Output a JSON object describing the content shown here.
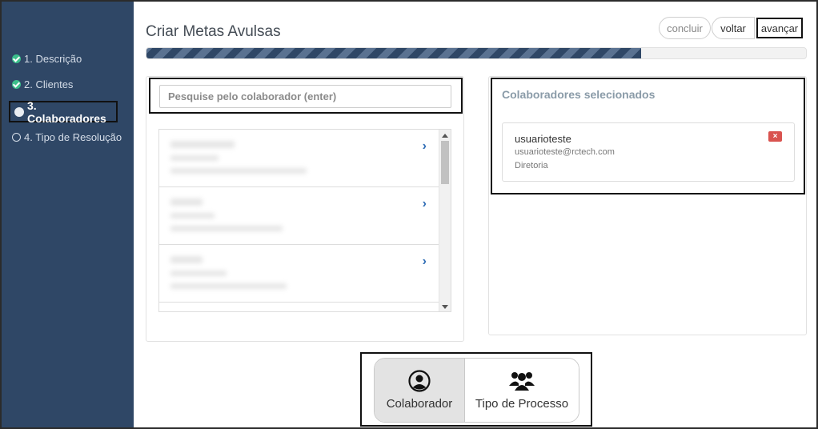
{
  "sidebar": {
    "steps": [
      {
        "label": "1. Descrição",
        "state": "done"
      },
      {
        "label": "2. Clientes",
        "state": "done"
      },
      {
        "label": "3. Colaboradores",
        "state": "current"
      },
      {
        "label": "4. Tipo de Resolução",
        "state": "todo"
      }
    ]
  },
  "header": {
    "title": "Criar Metas Avulsas",
    "buttons": {
      "concluir": "concluir",
      "voltar": "voltar",
      "avancar": "avançar"
    },
    "progress": 0.75
  },
  "search": {
    "placeholder": "Pesquise pelo colaborador (enter)"
  },
  "selected": {
    "title": "Colaboradores selecionados",
    "items": [
      {
        "name": "usuarioteste",
        "email": "usuarioteste@rctech.com",
        "dept": "Diretoria",
        "remove_label": "×"
      }
    ]
  },
  "mode_toggle": {
    "options": [
      {
        "label": "Colaborador",
        "icon": "user-circle-icon",
        "selected": true
      },
      {
        "label": "Tipo de Processo",
        "icon": "users-group-icon",
        "selected": false
      }
    ]
  },
  "colors": {
    "sidebar": "#2f4766",
    "accent": "#3bbf8b",
    "danger": "#d9534f",
    "link": "#2f6db5"
  }
}
